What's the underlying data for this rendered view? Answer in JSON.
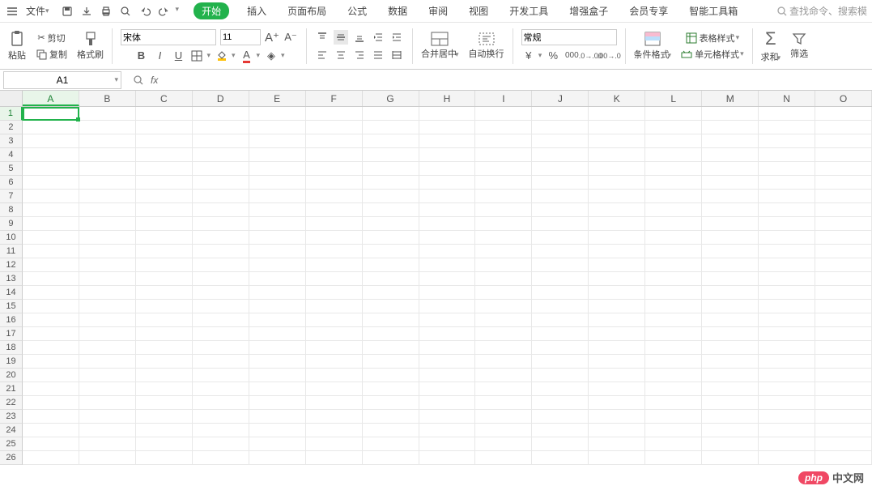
{
  "menubar": {
    "file": "文件",
    "tabs": [
      "开始",
      "插入",
      "页面布局",
      "公式",
      "数据",
      "审阅",
      "视图",
      "开发工具",
      "增强盒子",
      "会员专享",
      "智能工具箱"
    ],
    "active_tab_index": 0,
    "search_placeholder": "查找命令、搜索模"
  },
  "ribbon": {
    "paste": "粘贴",
    "cut": "剪切",
    "copy": "复制",
    "format_painter": "格式刷",
    "font_name": "宋体",
    "font_size": "11",
    "merge_center": "合并居中",
    "auto_wrap": "自动换行",
    "number_format": "常规",
    "cond_format": "条件格式",
    "table_style": "表格样式",
    "cell_style": "单元格样式",
    "sum": "求和",
    "filter": "筛选"
  },
  "formula_bar": {
    "name_box": "A1",
    "fx": "fx"
  },
  "grid": {
    "columns": [
      "A",
      "B",
      "C",
      "D",
      "E",
      "F",
      "G",
      "H",
      "I",
      "J",
      "K",
      "L",
      "M",
      "N",
      "O"
    ],
    "rows": [
      1,
      2,
      3,
      4,
      5,
      6,
      7,
      8,
      9,
      10,
      11,
      12,
      13,
      14,
      15,
      16,
      17,
      18,
      19,
      20,
      21,
      22,
      23,
      24,
      25,
      26
    ],
    "selected_col": 0,
    "selected_row": 0
  },
  "watermark": {
    "badge": "php",
    "text": "中文网"
  }
}
